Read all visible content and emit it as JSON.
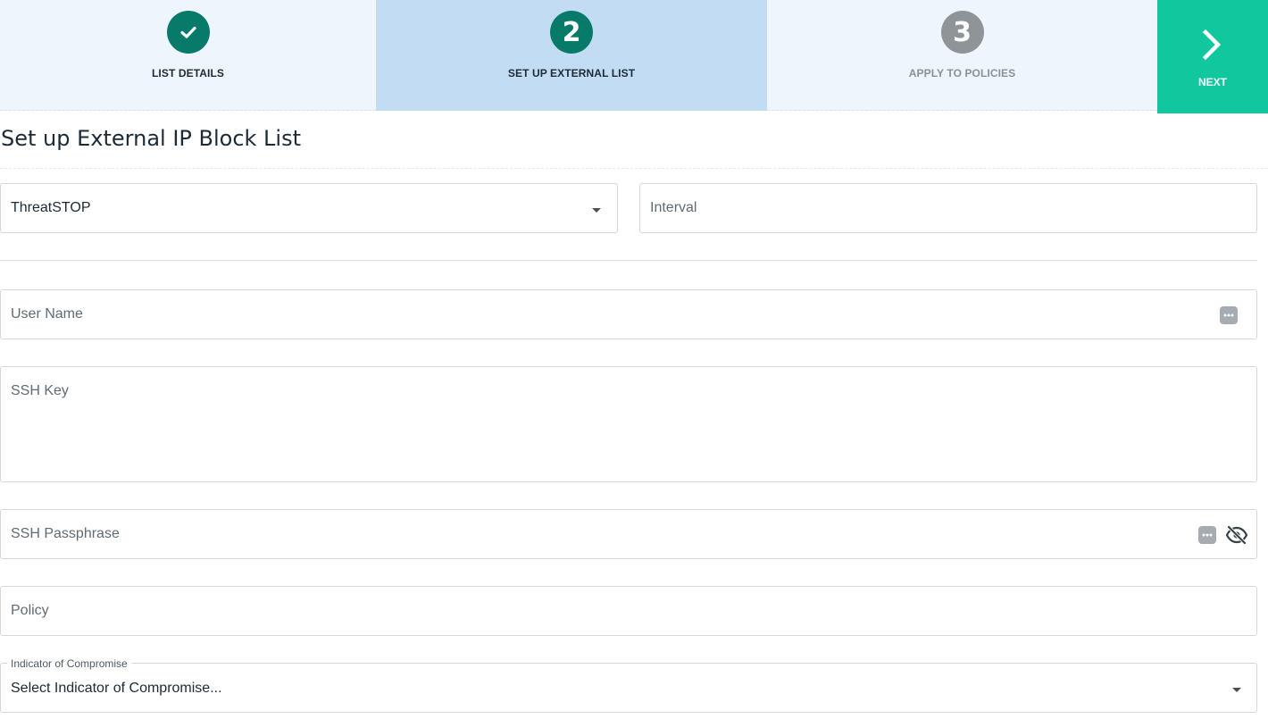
{
  "stepper": {
    "steps": [
      {
        "number": "",
        "label": "LIST DETAILS",
        "state": "done"
      },
      {
        "number": "2",
        "label": "SET UP EXTERNAL LIST",
        "state": "current"
      },
      {
        "number": "3",
        "label": "APPLY TO POLICIES",
        "state": "pending"
      }
    ],
    "next_label": "NEXT"
  },
  "page": {
    "title": "Set up External IP Block List"
  },
  "form": {
    "provider": {
      "value": "ThreatSTOP"
    },
    "interval": {
      "placeholder": "Interval"
    },
    "user_name": {
      "placeholder": "User Name"
    },
    "ssh_key": {
      "placeholder": "SSH Key"
    },
    "ssh_passphrase": {
      "placeholder": "SSH Passphrase"
    },
    "policy": {
      "placeholder": "Policy"
    },
    "ioc": {
      "label": "Indicator of Compromise",
      "value": "Select Indicator of Compromise..."
    }
  },
  "colors": {
    "accent": "#087a6a",
    "next_button": "#11c79e",
    "active_step_bg": "#c2dcf4",
    "step_bg": "#eef5fc"
  }
}
